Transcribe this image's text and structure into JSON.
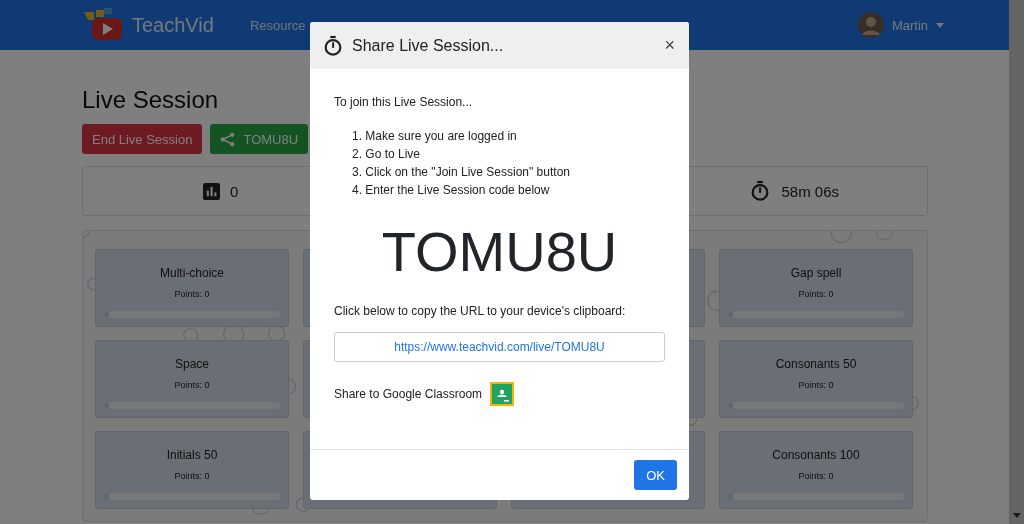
{
  "navbar": {
    "brand": "TeachVid",
    "links": [
      "Resource"
    ],
    "user": "Martin"
  },
  "page": {
    "title": "Live Session",
    "buttons": [
      {
        "kind": "end",
        "label": "End Live Session"
      },
      {
        "kind": "share",
        "label": "TOMU8U"
      }
    ],
    "stats": [
      {
        "kind": "count",
        "value": "0"
      },
      {
        "kind": "timer",
        "value": "58m 06s"
      }
    ],
    "cards": [
      {
        "title": "Multi-choice",
        "points": "Points: 0",
        "level": 0
      },
      {
        "title": "Gap spell",
        "points": "Points: 0",
        "level": 0
      },
      {
        "title": "Space",
        "points": "Points: 0",
        "level": 0
      },
      {
        "title": "Consonants 50",
        "points": "Points: 0",
        "level": 0
      },
      {
        "title": "Initials 50",
        "points": "Points: 0",
        "level": 0
      },
      {
        "title": "Consonants 100",
        "points": "Points: 0",
        "level": 0
      }
    ]
  },
  "modal": {
    "title": "Share Live Session...",
    "close": "×",
    "intro": "To join this Live Session...",
    "steps": [
      "1. Make sure you are logged in",
      "2. Go to Live",
      "3. Click on the \"Join Live Session\" button",
      "4. Enter the Live Session code below"
    ],
    "code": "TOMU8U",
    "copy_text": "Click below to copy the URL to your device's clipboard:",
    "url": "https://www.teachvid.com/live/TOMU8U",
    "classroom_text": "Share to Google Classroom",
    "ok": "OK"
  }
}
